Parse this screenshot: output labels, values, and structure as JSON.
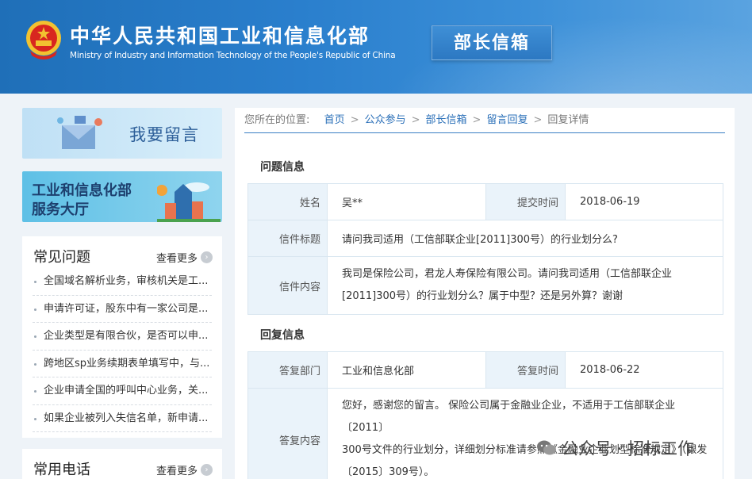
{
  "header": {
    "site_title": "中华人民共和国工业和信息化部",
    "site_subtitle": "Ministry of Industry and Information Technology of the People's Republic of China",
    "mailbox_label": "部长信箱",
    "colors": {
      "primary": "#1f6fb8",
      "accent": "#3b8fd8"
    }
  },
  "sidebar": {
    "banner_leave_message": "我要留言",
    "banner_service_line1": "工业和信息化部",
    "banner_service_line2": "服务大厅",
    "faq": {
      "title": "常见问题",
      "more_label": "查看更多",
      "items": [
        "全国域名解析业务，审核机关是工...",
        "申请许可证，股东中有一家公司是...",
        "企业类型是有限合伙，是否可以申...",
        "跨地区sp业务续期表单填写中，与...",
        "企业申请全国的呼叫中心业务，关...",
        "如果企业被列入失信名单，新申请..."
      ]
    },
    "phone": {
      "title": "常用电话",
      "more_label": "查看更多"
    }
  },
  "breadcrumb": {
    "prefix": "您所在的位置:",
    "items": [
      "首页",
      "公众参与",
      "部长信箱",
      "留言回复"
    ],
    "current": "回复详情"
  },
  "question": {
    "section_title": "问题信息",
    "name_label": "姓名",
    "name_value": "吴**",
    "date_label": "提交时间",
    "date_value": "2018-06-19",
    "subject_label": "信件标题",
    "subject_value": "请问我司适用（工信部联企业[2011]300号）的行业划分么?",
    "content_label": "信件内容",
    "content_line1": "我司是保险公司，君龙人寿保险有限公司。请问我司适用（工信部联企业",
    "content_line2": "[2011]300号）的行业划分么？属于中型？还是另外算？谢谢"
  },
  "reply": {
    "section_title": "回复信息",
    "dept_label": "答复部门",
    "dept_value": "工业和信息化部",
    "date_label": "答复时间",
    "date_value": "2018-06-22",
    "content_label": "答复内容",
    "content_line1": "您好，感谢您的留言。 保险公司属于金融业企业，不适用于工信部联企业〔2011〕",
    "content_line2": "300号文件的行业划分，详细划分标准请参照《金融业企业划型标准规定》（银发",
    "content_line3": "〔2015〕309号）。"
  },
  "watermark": {
    "text": "公众号 · 招标工作",
    "icon": "wechat-icon"
  }
}
